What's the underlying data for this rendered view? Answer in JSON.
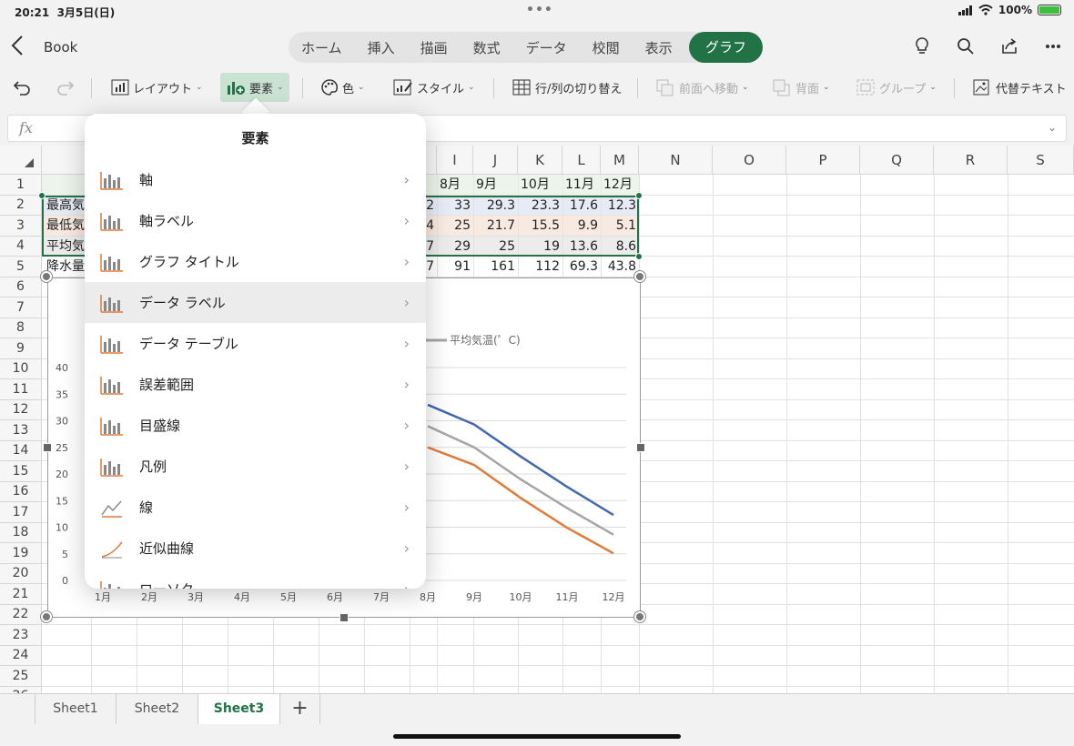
{
  "status": {
    "time": "20:21",
    "date": "3月5日(日)",
    "battery": "100%"
  },
  "header": {
    "back_label": "Book",
    "tabs": [
      "ホーム",
      "挿入",
      "描画",
      "数式",
      "データ",
      "校閲",
      "表示"
    ],
    "active_tab": "グラフ"
  },
  "ribbon": {
    "layout": "レイアウト",
    "elements": "要素",
    "color": "色",
    "style": "スタイル",
    "switch_rowcol": "行/列の切り替え",
    "bring_forward": "前面へ移動",
    "send_back": "背面",
    "group": "グループ",
    "alt_text": "代替テキスト"
  },
  "formula_bar": {
    "fx": "fx",
    "value": ""
  },
  "columns": [
    "I",
    "J",
    "K",
    "L",
    "M",
    "N",
    "O",
    "P",
    "Q",
    "R",
    "S"
  ],
  "rows": [
    "1",
    "2",
    "3",
    "4",
    "5",
    "6",
    "7",
    "8",
    "9",
    "10",
    "11",
    "12",
    "13",
    "14",
    "15",
    "16",
    "17",
    "18",
    "19",
    "20",
    "21",
    "22",
    "23",
    "24",
    "25",
    "26"
  ],
  "sheet_cells": {
    "row_labels": [
      "最高気",
      "最低気",
      "平均気",
      "降水量"
    ],
    "h_partial": [
      "",
      "2",
      "4",
      "7",
      "7"
    ],
    "months": [
      "8月",
      "9月",
      "10月",
      "11月",
      "12月"
    ],
    "max_temp": [
      "33",
      "29.3",
      "23.3",
      "17.6",
      "12.3"
    ],
    "min_temp": [
      "25",
      "21.7",
      "15.5",
      "9.9",
      "5.1"
    ],
    "avg_temp": [
      "29",
      "25",
      "19",
      "13.6",
      "8.6"
    ],
    "precip": [
      "91",
      "161",
      "112",
      "69.3",
      "43.8"
    ]
  },
  "chart_data": {
    "type": "line",
    "categories": [
      "1月",
      "2月",
      "3月",
      "4月",
      "5月",
      "6月",
      "7月",
      "8月",
      "9月",
      "10月",
      "11月",
      "12月"
    ],
    "ylim": [
      0,
      40
    ],
    "yticks": [
      "0",
      "5",
      "10",
      "15",
      "20",
      "25",
      "30",
      "35",
      "40"
    ],
    "legend_visible": "平均気温(゜C)",
    "series": [
      {
        "name": "最高気温",
        "color": "#4468b0",
        "visible_from": 7,
        "values": [
          null,
          null,
          null,
          null,
          null,
          null,
          null,
          33,
          29.3,
          23.3,
          17.6,
          12.3
        ]
      },
      {
        "name": "最低気温",
        "color": "#e07b39",
        "visible_from": 7,
        "values": [
          null,
          null,
          null,
          null,
          null,
          null,
          null,
          25,
          21.7,
          15.5,
          9.9,
          5.1
        ]
      },
      {
        "name": "平均気温(゜C)",
        "color": "#a5a5a5",
        "visible_from": 7,
        "values": [
          null,
          null,
          null,
          null,
          null,
          null,
          null,
          29,
          25,
          19,
          13.6,
          8.6
        ]
      }
    ]
  },
  "popover": {
    "title": "要素",
    "items": [
      "軸",
      "軸ラベル",
      "グラフ タイトル",
      "データ ラベル",
      "データ テーブル",
      "誤差範囲",
      "目盛線",
      "凡例",
      "線",
      "近似曲線",
      "ローソク"
    ],
    "highlighted_index": 3
  },
  "sheets": [
    "Sheet1",
    "Sheet2",
    "Sheet3"
  ],
  "active_sheet": "Sheet3",
  "icons": {
    "back": "chevron-left-icon",
    "lightbulb": "lightbulb-icon",
    "search": "search-icon",
    "share": "share-icon",
    "more": "more-icon",
    "undo": "undo-icon",
    "redo": "redo-icon"
  },
  "colors": {
    "accent": "#217346",
    "ribbon_selected": "#c9e2d2"
  }
}
